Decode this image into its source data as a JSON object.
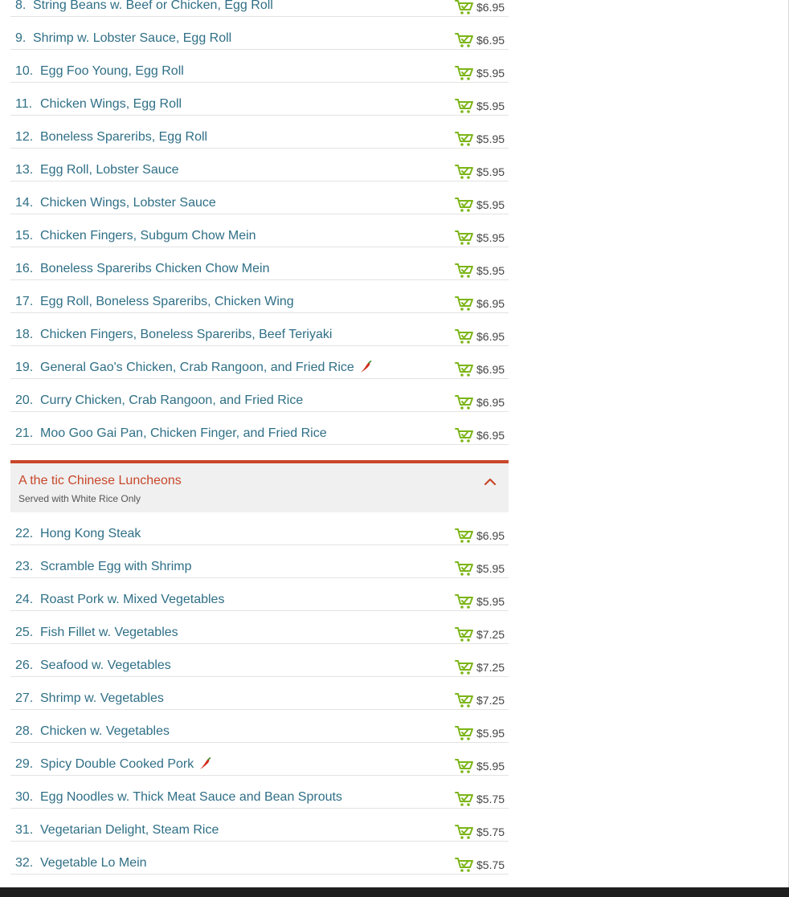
{
  "colors": {
    "item_text": "#2f6f86",
    "cart_green": "#7cb518",
    "section_accent": "#c8472a",
    "price_text": "#444444"
  },
  "icons": {
    "cart": "shopping-cart-icon",
    "spicy": "chili-pepper-icon",
    "collapse": "chevron-up-icon"
  },
  "combo_items": [
    {
      "num": "8.",
      "name": "String Beans w. Beef or Chicken, Egg Roll",
      "price": "$6.95",
      "spicy": false
    },
    {
      "num": "9.",
      "name": "Shrimp w. Lobster Sauce, Egg Roll",
      "price": "$6.95",
      "spicy": false
    },
    {
      "num": "10.",
      "name": "Egg Foo Young, Egg Roll",
      "price": "$5.95",
      "spicy": false
    },
    {
      "num": "11.",
      "name": "Chicken Wings, Egg Roll",
      "price": "$5.95",
      "spicy": false
    },
    {
      "num": "12.",
      "name": "Boneless Spareribs, Egg Roll",
      "price": "$5.95",
      "spicy": false
    },
    {
      "num": "13.",
      "name": "Egg Roll, Lobster Sauce",
      "price": "$5.95",
      "spicy": false
    },
    {
      "num": "14.",
      "name": "Chicken Wings, Lobster Sauce",
      "price": "$5.95",
      "spicy": false
    },
    {
      "num": "15.",
      "name": "Chicken Fingers, Subgum Chow Mein",
      "price": "$5.95",
      "spicy": false
    },
    {
      "num": "16.",
      "name": "Boneless Spareribs Chicken Chow Mein",
      "price": "$5.95",
      "spicy": false
    },
    {
      "num": "17.",
      "name": "Egg Roll, Boneless Spareribs, Chicken Wing",
      "price": "$6.95",
      "spicy": false
    },
    {
      "num": "18.",
      "name": "Chicken Fingers, Boneless Spareribs, Beef Teriyaki",
      "price": "$6.95",
      "spicy": false
    },
    {
      "num": "19.",
      "name": "General Gao's Chicken, Crab Rangoon, and Fried Rice",
      "price": "$6.95",
      "spicy": true
    },
    {
      "num": "20.",
      "name": "Curry Chicken, Crab Rangoon, and Fried Rice",
      "price": "$6.95",
      "spicy": false
    },
    {
      "num": "21.",
      "name": "Moo Goo Gai Pan, Chicken Finger, and Fried Rice",
      "price": "$6.95",
      "spicy": false
    }
  ],
  "section": {
    "title": "A the tic Chinese Luncheons",
    "subtitle": "Served with White Rice Only"
  },
  "luncheon_items": [
    {
      "num": "22.",
      "name": "Hong Kong Steak",
      "price": "$6.95",
      "spicy": false
    },
    {
      "num": "23.",
      "name": "Scramble Egg with Shrimp",
      "price": "$5.95",
      "spicy": false
    },
    {
      "num": "24.",
      "name": "Roast Pork w. Mixed Vegetables",
      "price": "$5.95",
      "spicy": false
    },
    {
      "num": "25.",
      "name": "Fish Fillet w. Vegetables",
      "price": "$7.25",
      "spicy": false
    },
    {
      "num": "26.",
      "name": "Seafood w. Vegetables",
      "price": "$7.25",
      "spicy": false
    },
    {
      "num": "27.",
      "name": "Shrimp w. Vegetables",
      "price": "$7.25",
      "spicy": false
    },
    {
      "num": "28.",
      "name": "Chicken w. Vegetables",
      "price": "$5.95",
      "spicy": false
    },
    {
      "num": "29.",
      "name": "Spicy Double Cooked Pork",
      "price": "$5.95",
      "spicy": true
    },
    {
      "num": "30.",
      "name": "Egg Noodles w. Thick Meat Sauce and Bean Sprouts",
      "price": "$5.75",
      "spicy": false
    },
    {
      "num": "31.",
      "name": "Vegetarian Delight, Steam Rice",
      "price": "$5.75",
      "spicy": false
    },
    {
      "num": "32.",
      "name": "Vegetable Lo Mein",
      "price": "$5.75",
      "spicy": false
    }
  ]
}
